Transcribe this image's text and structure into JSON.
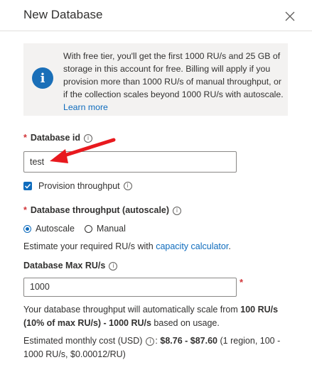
{
  "panel": {
    "title": "New Database",
    "close_icon": "close-icon"
  },
  "info": {
    "icon": "info-icon",
    "text": "With free tier, you'll get the first 1000 RU/s and 25 GB of storage in this account for free. Billing will apply if you provision more than 1000 RU/s of manual throughput, or if the collection scales beyond 1000 RU/s with autoscale.",
    "link": "Learn more"
  },
  "database_id": {
    "required_mark": "*",
    "label": "Database id",
    "value": "test"
  },
  "provision": {
    "label": "Provision throughput",
    "checked": true
  },
  "throughput": {
    "required_mark": "*",
    "label": "Database throughput (autoscale)",
    "options": [
      "Autoscale",
      "Manual"
    ],
    "selected": "Autoscale",
    "estimate_prefix": "Estimate your required RU/s with ",
    "estimate_link": "capacity calculator",
    "estimate_suffix": "."
  },
  "max_rus": {
    "label": "Database Max RU/s",
    "value": "1000",
    "required_mark": "*"
  },
  "scale_note": {
    "prefix": "Your database throughput will automatically scale from ",
    "bold": "100 RU/s (10% of max RU/s) - 1000 RU/s",
    "suffix": " based on usage."
  },
  "cost": {
    "label": "Estimated monthly cost (USD)",
    "colon": ":",
    "bold": "$8.76 - $87.60",
    "detail": " (1 region, 100 - 1000 RU/s, $0.00012/RU)"
  },
  "colors": {
    "accent": "#0f6cbd",
    "required": "#d13438",
    "annotation_arrow": "#e8191e"
  }
}
